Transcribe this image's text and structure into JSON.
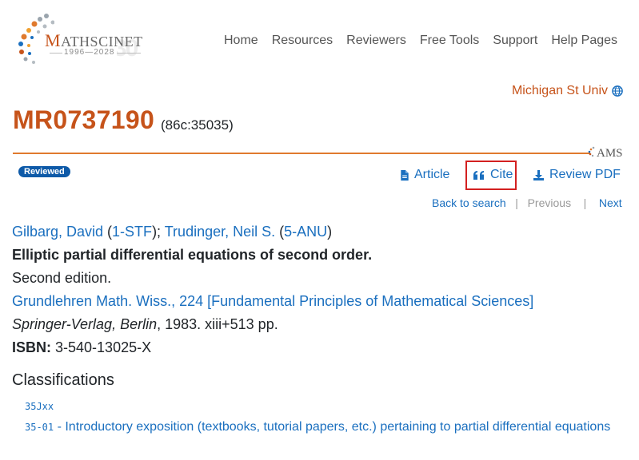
{
  "brand": {
    "name_prefix": "M",
    "name_rest": "ATHSCINET",
    "years": "1996—2028"
  },
  "nav": [
    "Home",
    "Resources",
    "Reviewers",
    "Free Tools",
    "Support",
    "Help Pages"
  ],
  "institution": "Michigan St Univ",
  "record": {
    "mr_number": "MR0737190",
    "old_number": "(86c:35035)",
    "badge": "Reviewed"
  },
  "actions": {
    "article": "Article",
    "cite": "Cite",
    "review_pdf": "Review PDF"
  },
  "subnav": {
    "back": "Back to search",
    "previous": "Previous",
    "next": "Next"
  },
  "publication": {
    "author1": "Gilbarg, David",
    "author1_inst": "1-STF",
    "author2": "Trudinger, Neil S.",
    "author2_inst": "5-ANU",
    "title": "Elliptic partial differential equations of second order.",
    "edition": "Second edition.",
    "series": "Grundlehren Math. Wiss., 224 [Fundamental Principles of Mathematical Sciences]",
    "publisher": "Springer-Verlag, Berlin",
    "pub_details": ", 1983. xiii+513 pp.",
    "isbn_label": "ISBN:",
    "isbn": "3-540-13025-X"
  },
  "classifications": {
    "heading": "Classifications",
    "primary": "35Jxx",
    "secondary_code": "35-01",
    "secondary_desc": " - Introductory exposition (textbooks, tutorial papers, etc.) pertaining to partial differential equations"
  },
  "ams_logo": "AMS",
  "colors": {
    "accent": "#c6531a",
    "link": "#1a6fbf",
    "badge": "#0e5aa8",
    "highlight": "#d32020"
  }
}
